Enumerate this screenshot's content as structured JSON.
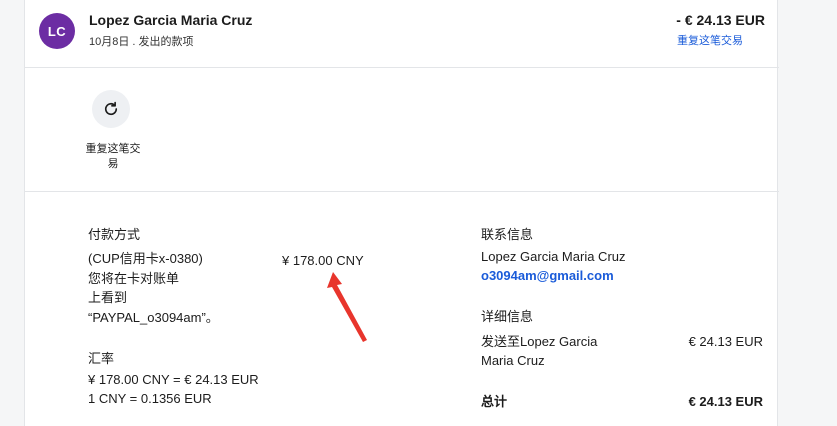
{
  "header": {
    "avatar_initials": "LC",
    "name": "Lopez Garcia Maria Cruz",
    "date_line": "10月8日 . 发出的款项",
    "amount": "- € 24.13 EUR",
    "repeat_link": "重复这笔交易"
  },
  "actions": {
    "repeat_icon": "refresh-icon",
    "repeat_label": "重复这笔交易"
  },
  "payment": {
    "title": "付款方式",
    "card": "(CUP信用卡x-0380)",
    "cny_amount": "¥ 178.00 CNY",
    "note_1": "您将在卡对账单",
    "note_2": "上看到",
    "note_3": "“PAYPAL_o3094am”。"
  },
  "exchange": {
    "title": "汇率",
    "line1": "¥ 178.00 CNY = € 24.13 EUR",
    "line2": "1 CNY = 0.1356 EUR"
  },
  "contact": {
    "title": "联系信息",
    "name": "Lopez Garcia Maria Cruz",
    "email": "o3094am@gmail.com"
  },
  "details": {
    "title": "详细信息",
    "sent_to_1": "发送至Lopez Garcia",
    "sent_to_2": "Maria Cruz",
    "sent_amount": "€ 24.13 EUR",
    "total_label": "总计",
    "total_amount": "€ 24.13 EUR"
  },
  "colors": {
    "avatar": "#6c2da3",
    "link": "#1a5bd9",
    "arrow": "#e8352c"
  }
}
